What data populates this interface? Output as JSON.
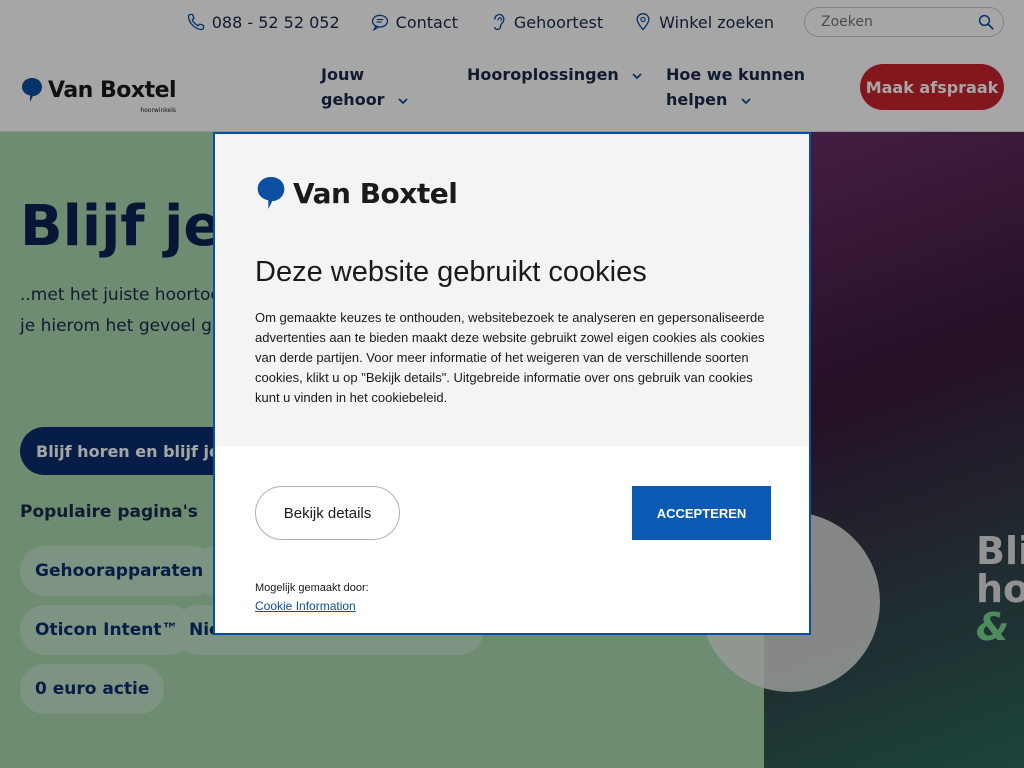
{
  "topbar": {
    "phone": "088 - 52 52 052",
    "contact": "Contact",
    "hearing_test": "Gehoortest",
    "store_finder": "Winkel zoeken",
    "search_placeholder": "Zoeken"
  },
  "nav": {
    "logo_brand": "Van Boxtel",
    "logo_sub": "hoorwinkels",
    "items": [
      {
        "label": "Jouw gehoor"
      },
      {
        "label": "Hooroplossingen"
      },
      {
        "label": "Hoe we kunnen helpen"
      }
    ],
    "cta": "Maak afspraak"
  },
  "hero": {
    "title": "Blijf jez",
    "text": "..met het juiste hoortoest en hoe je de wereld erva je hierom het gevoel gev gehoorverlies je niet teg",
    "button": "Blijf horen en blijf jeze",
    "popular_label": "Populaire pagina's",
    "pills": [
      "Gehoorapparaten",
      "",
      "Oticon Intent™",
      "Nie",
      "0 euro actie"
    ],
    "promo_line1": "Bli",
    "promo_line2": "ho",
    "promo_line3": "& "
  },
  "modal": {
    "logo_brand": "Van Boxtel",
    "title": "Deze website gebruikt cookies",
    "body": "Om gemaakte keuzes te onthouden, websitebezoek te analyseren en gepersonaliseerde advertenties aan te bieden maakt deze website gebruikt zowel eigen cookies als cookies van derde partijen. Voor meer informatie of het weigeren van de verschillende soorten cookies, klikt u op \"Bekijk details\". Uitgebreide informatie over ons gebruik van cookies kunt u vinden in het cookiebeleid.",
    "details_button": "Bekijk details",
    "accept_button": "ACCEPTEREN",
    "powered_by": "Mogelijk gemaakt door:",
    "powered_link": "Cookie Information"
  },
  "colors": {
    "brand_blue": "#0a4fa0",
    "cta_red": "#c8262e",
    "hero_green": "#a8d8b0",
    "accept_blue": "#0a5ab4"
  },
  "icons": [
    "phone-icon",
    "chat-icon",
    "ear-icon",
    "location-pin-icon",
    "search-icon",
    "chevron-down-icon",
    "logo-drop-icon"
  ]
}
